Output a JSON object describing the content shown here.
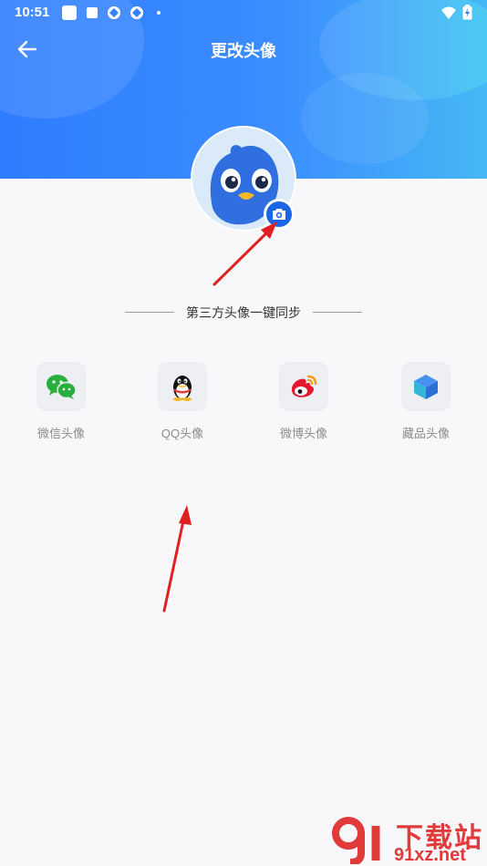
{
  "status_bar": {
    "time": "10:51"
  },
  "header": {
    "title": "更改头像"
  },
  "sync": {
    "label": "第三方头像一键同步"
  },
  "options": [
    {
      "label": "微信头像",
      "icon": "wechat-icon"
    },
    {
      "label": "QQ头像",
      "icon": "qq-icon"
    },
    {
      "label": "微博头像",
      "icon": "weibo-icon"
    },
    {
      "label": "藏品头像",
      "icon": "cube-icon"
    }
  ],
  "watermark": {
    "title": "下载站",
    "url": "91xz.net"
  },
  "colors": {
    "header_start": "#2f7dff",
    "header_end": "#45b8f5",
    "accent": "#1a66e6",
    "arrow": "#e02020"
  }
}
